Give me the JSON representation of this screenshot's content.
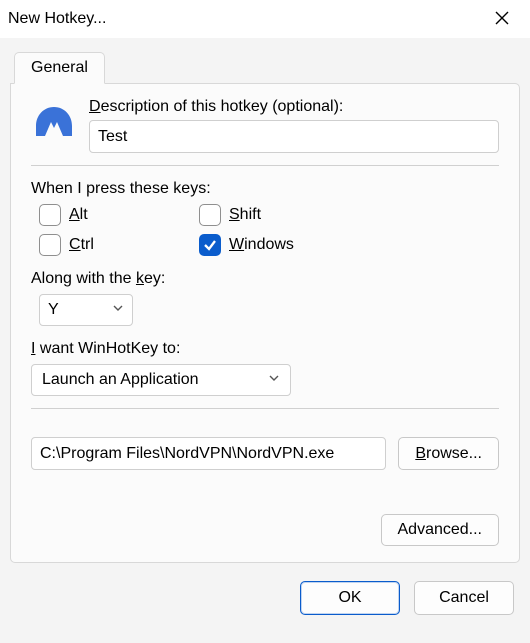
{
  "window": {
    "title": "New Hotkey..."
  },
  "tabs": {
    "general": "General"
  },
  "description": {
    "label_prefix_u": "D",
    "label_rest": "escription of this hotkey (optional):",
    "value": "Test"
  },
  "modifiers": {
    "heading": "When I press these keys:",
    "alt": {
      "label_prefix_u": "A",
      "label_rest": "lt",
      "checked": false
    },
    "shift": {
      "label_prefix_u": "S",
      "label_rest": "hift",
      "checked": false
    },
    "ctrl": {
      "label_prefix_u": "C",
      "label_rest": "trl",
      "checked": false
    },
    "windows": {
      "label_prefix_u": "W",
      "label_rest": "indows",
      "checked": true
    }
  },
  "key": {
    "label_before": "Along with the ",
    "label_u": "k",
    "label_after": "ey:",
    "value": "Y"
  },
  "action": {
    "label_prefix_u": "I",
    "label_rest": " want WinHotKey to:",
    "value": "Launch an Application"
  },
  "target": {
    "path": "C:\\Program Files\\NordVPN\\NordVPN.exe",
    "browse_prefix_u": "B",
    "browse_rest": "rowse..."
  },
  "advanced": {
    "label": "Advanced..."
  },
  "buttons": {
    "ok": "OK",
    "cancel": "Cancel"
  }
}
